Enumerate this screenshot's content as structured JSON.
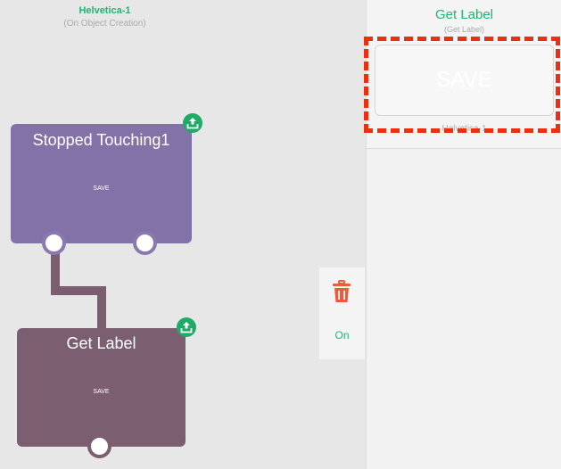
{
  "canvas": {
    "font_title": "Helvetica-1",
    "font_subtitle": "(On Object Creation)",
    "nodes": [
      {
        "title": "Stopped Touching1",
        "save_label": "SAVE"
      },
      {
        "title": "Get Label",
        "save_label": "SAVE"
      }
    ]
  },
  "side_strip": {
    "trash_icon": "trash-icon",
    "on_label": "On"
  },
  "panel": {
    "title": "Get Label",
    "subtitle": "(Get Label)",
    "preview_text": "SAVE",
    "font_label": "Helvetica-1"
  },
  "colors": {
    "accent_green": "#1fb571",
    "node_purple": "#8272a7",
    "node_mauve": "#7c5e71",
    "highlight_red": "#ee2e10"
  }
}
